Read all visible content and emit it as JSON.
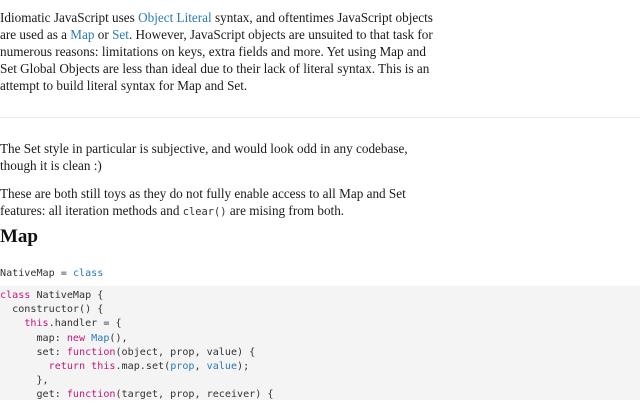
{
  "intro": {
    "t1": "Idiomatic JavaScript uses ",
    "link_object_literal": "Object Literal",
    "t2": " syntax, and oftentimes JavaScript objects are used as a ",
    "link_map": "Map",
    "t3": " or ",
    "link_set": "Set",
    "t4": ". However, JavaScript objects are unsuited to that task for numerous reasons: limitations on keys, extra fields and more. Yet using Map and Set Global Objects are less than ideal due to their lack of literal syntax. This is an attempt to build literal syntax for Map and Set."
  },
  "set_style": "The Set style in particular is subjective, and would look odd in any codebase, though it is clean :)",
  "toys": {
    "t1": "These are both still toys as they do not fully enable access to all Map and Set features: all iteration methods and ",
    "code": "clear()",
    "t2": " are mising from both."
  },
  "heading_map": "Map",
  "native_line": {
    "lhs": "NativeMap = ",
    "kw": "class"
  },
  "code": {
    "l1_kw": "class",
    "l1_rest": " NativeMap {",
    "l2": "  constructor() {",
    "l3_indent": "    ",
    "l3_kw": "this",
    "l3_rest": ".handler = {",
    "l4_a": "      map: ",
    "l4_kw": "new",
    "l4_sp": " ",
    "l4_cls": "Map",
    "l4_b": "(),",
    "l5_a": "      set: ",
    "l5_kw": "function",
    "l5_b": "(object, prop, value) {",
    "l6_indent": "        ",
    "l6_kw1": "return",
    "l6_sp": " ",
    "l6_kw2": "this",
    "l6_a": ".map.set(",
    "l6_p1": "prop",
    "l6_c": ", ",
    "l6_p2": "value",
    "l6_b": ");",
    "l7": "      },",
    "l8_a": "      get: ",
    "l8_kw": "function",
    "l8_b": "(target, prop, receiver) {"
  }
}
